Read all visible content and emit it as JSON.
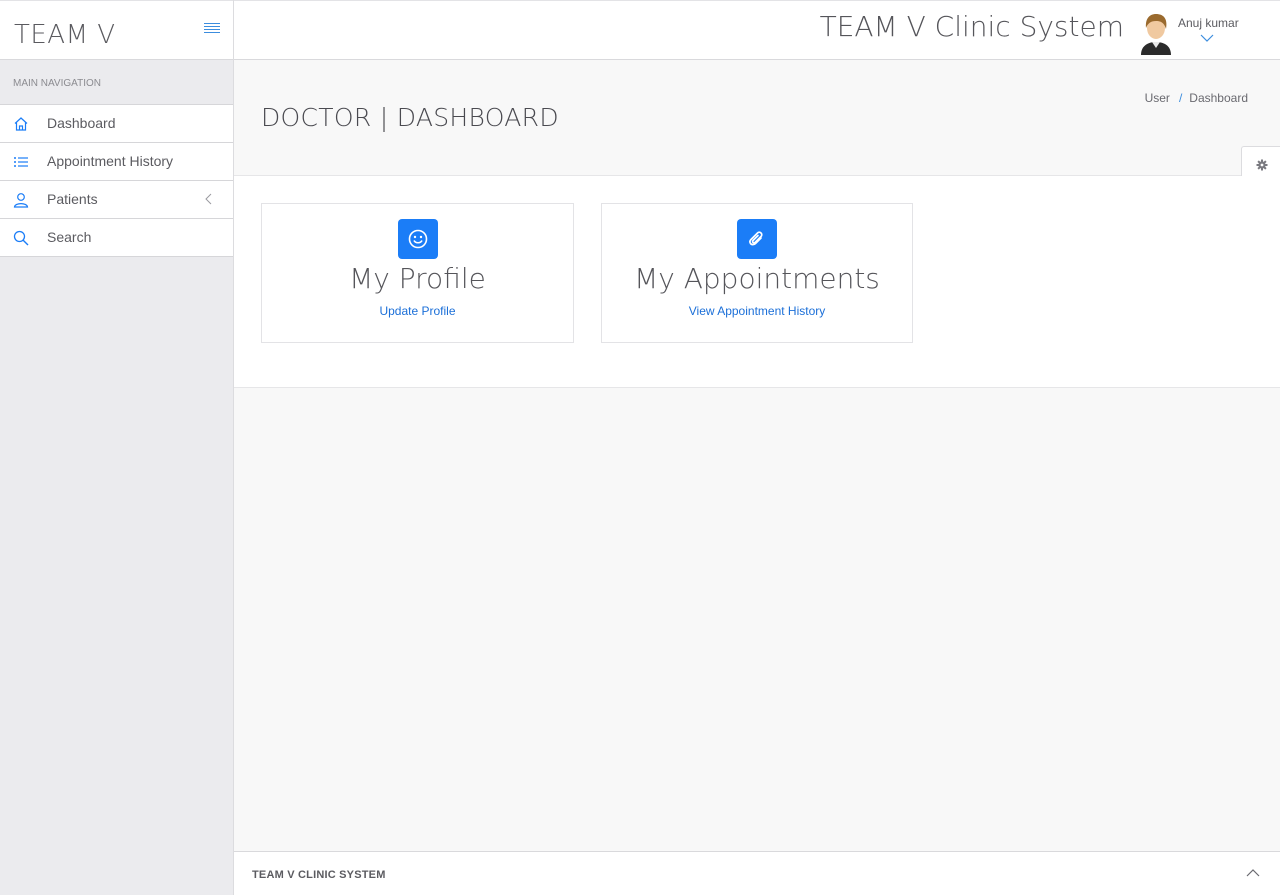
{
  "sidebar": {
    "brand": "TEAM V",
    "nav_heading": "MAIN NAVIGATION",
    "items": [
      {
        "label": "Dashboard",
        "icon": "home-icon"
      },
      {
        "label": "Appointment History",
        "icon": "list-icon"
      },
      {
        "label": "Patients",
        "icon": "user-icon"
      },
      {
        "label": "Search",
        "icon": "search-icon"
      }
    ]
  },
  "topbar": {
    "app_title": "TEAM V Clinic System",
    "user_name": "Anuj kumar"
  },
  "page_header": {
    "title": "DOCTOR | DASHBOARD",
    "breadcrumb": [
      "User",
      "Dashboard"
    ],
    "breadcrumb_separator": "/"
  },
  "cards": [
    {
      "title": "My Profile",
      "link": "Update Profile",
      "icon": "smile-icon"
    },
    {
      "title": "My Appointments",
      "link": "View Appointment History",
      "icon": "paperclip-icon"
    }
  ],
  "footer": {
    "text": "TEAM V CLINIC SYSTEM"
  },
  "colors": {
    "accent": "#1b7df7",
    "link": "#1b6fd8",
    "sidebar_bg": "#ebebee"
  }
}
